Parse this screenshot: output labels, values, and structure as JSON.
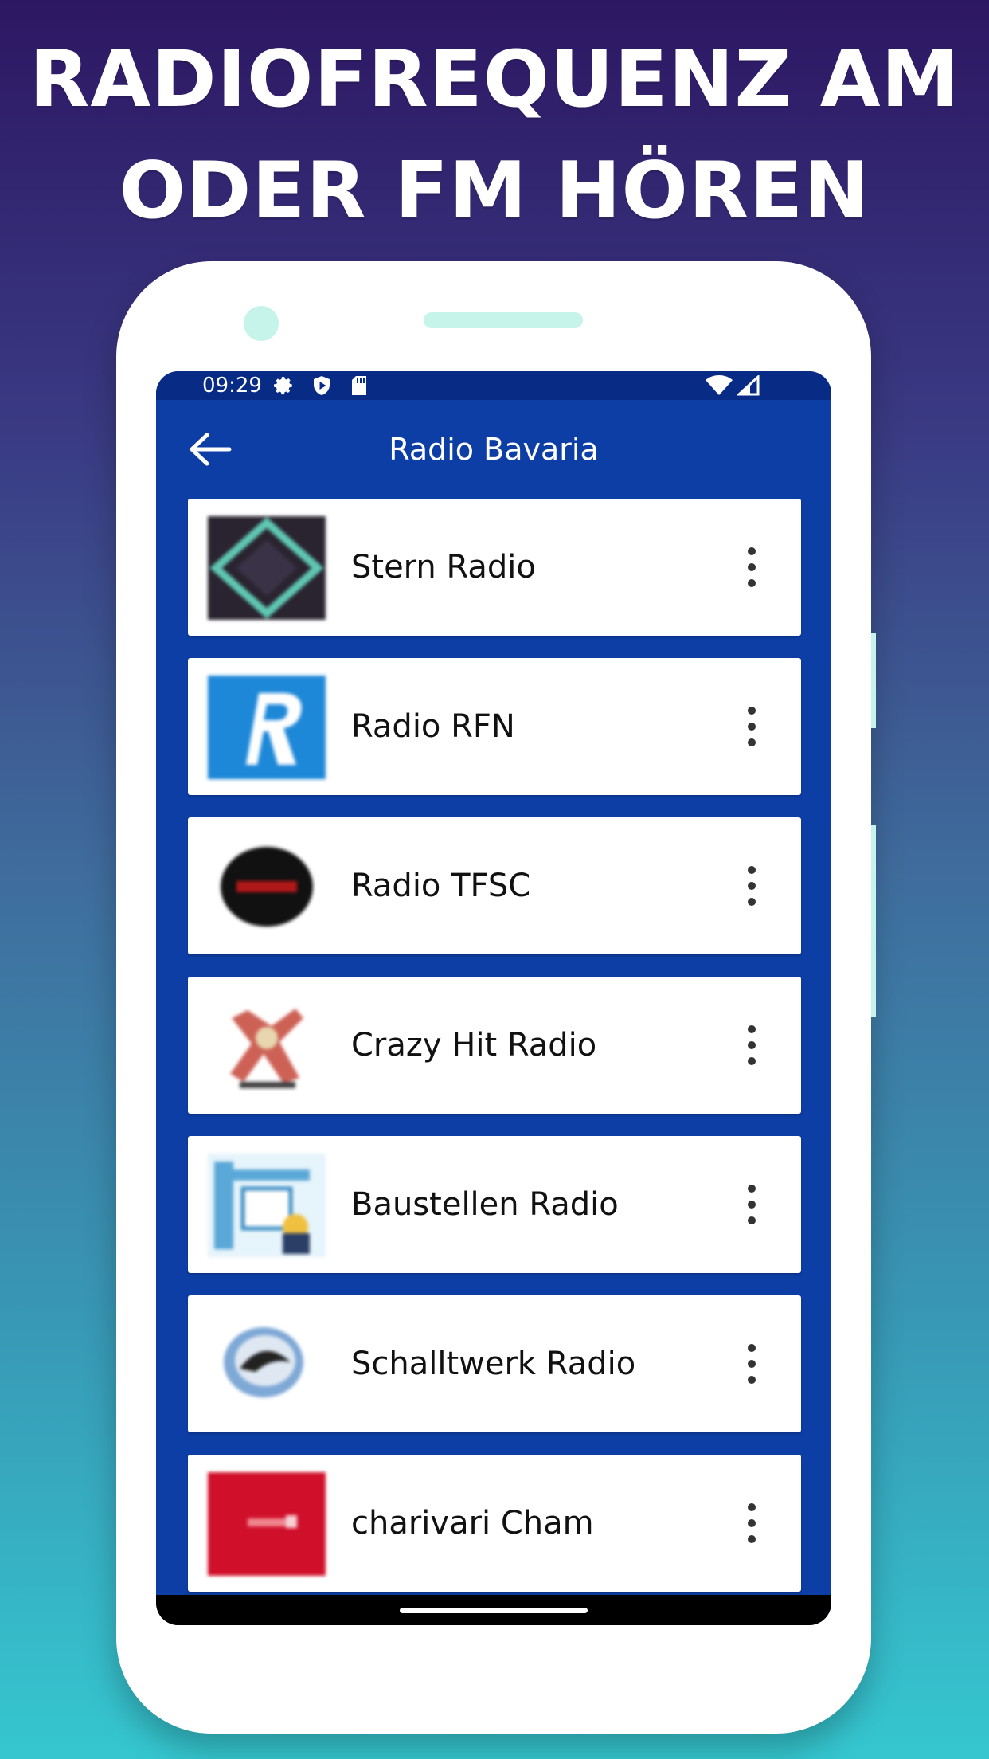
{
  "promo": {
    "line1": "RADIOFREQUENZ AM",
    "line2": "ODER FM HÖREN"
  },
  "status_bar": {
    "time": "09:29",
    "icons": [
      "gear-icon",
      "shield-play-icon",
      "sd-card-icon",
      "wifi-icon",
      "signal-icon"
    ]
  },
  "app_bar": {
    "title": "Radio Bavaria",
    "back_icon": "arrow-left-icon"
  },
  "stations": [
    {
      "name": "Stern Radio"
    },
    {
      "name": "Radio RFN"
    },
    {
      "name": "Radio TFSC"
    },
    {
      "name": "Crazy Hit Radio"
    },
    {
      "name": "Baustellen Radio"
    },
    {
      "name": "Schalltwerk Radio"
    },
    {
      "name": "charivari Cham"
    }
  ],
  "colors": {
    "app_bar": "#0d3ea6",
    "status_bar": "#082c86",
    "card": "#ffffff",
    "phone_accent": "#c6f3ea"
  }
}
